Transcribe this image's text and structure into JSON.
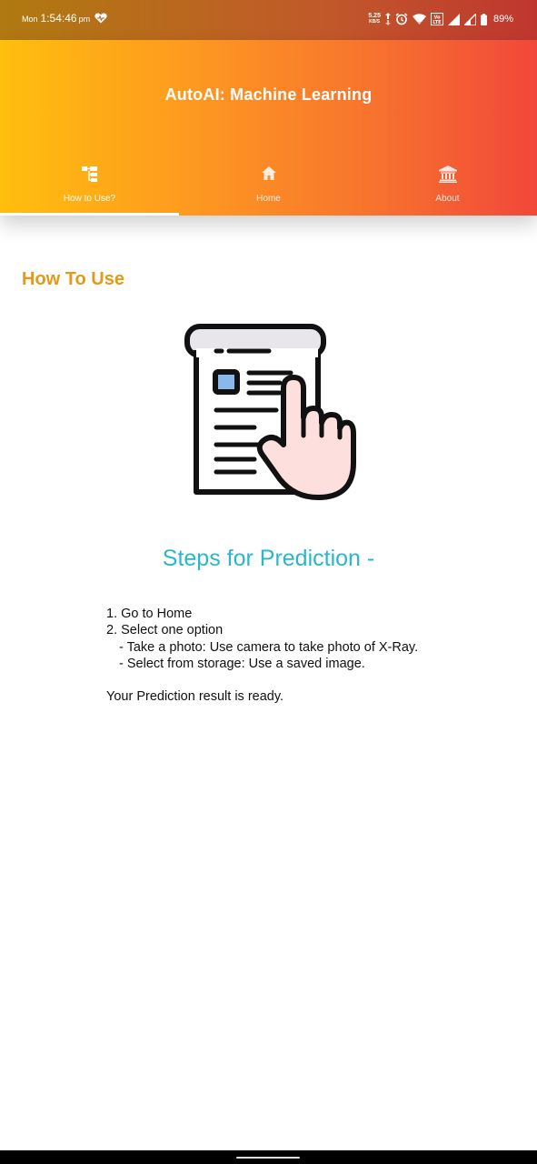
{
  "status_bar": {
    "day": "Mon",
    "time": "1:54:46",
    "ampm": "pm",
    "net_speed_value": "5.25",
    "net_speed_unit": "KB/S",
    "network_label": "VoLTE",
    "battery": "89%",
    "icons": [
      "heart-icon",
      "data-transfer-icon",
      "alarm-icon",
      "wifi-icon",
      "volte-icon",
      "signal-icon",
      "signal-icon-2",
      "battery-icon"
    ]
  },
  "app_bar": {
    "title": "AutoAI: Machine Learning",
    "gradient": [
      "#ffbf0d",
      "#fd9422",
      "#f7722e",
      "#f1473a"
    ],
    "tabs": [
      {
        "label": "How to Use?",
        "icon": "sitemap-icon",
        "active": true
      },
      {
        "label": "Home",
        "icon": "home-icon",
        "active": false
      },
      {
        "label": "About",
        "icon": "institution-icon",
        "active": false
      }
    ]
  },
  "main": {
    "heading": "How To Use",
    "heading_color": "#e39a18",
    "illustration_icon": "document-hand-icon",
    "steps_title": "Steps for Prediction -",
    "steps_title_color": "#2ab7c7",
    "steps": [
      "1. Go to Home",
      "2. Select one option",
      "- Take a photo: Use camera to take photo of X-Ray.",
      "- Select from storage: Use a saved image."
    ],
    "result_text": "Your Prediction result is ready."
  }
}
